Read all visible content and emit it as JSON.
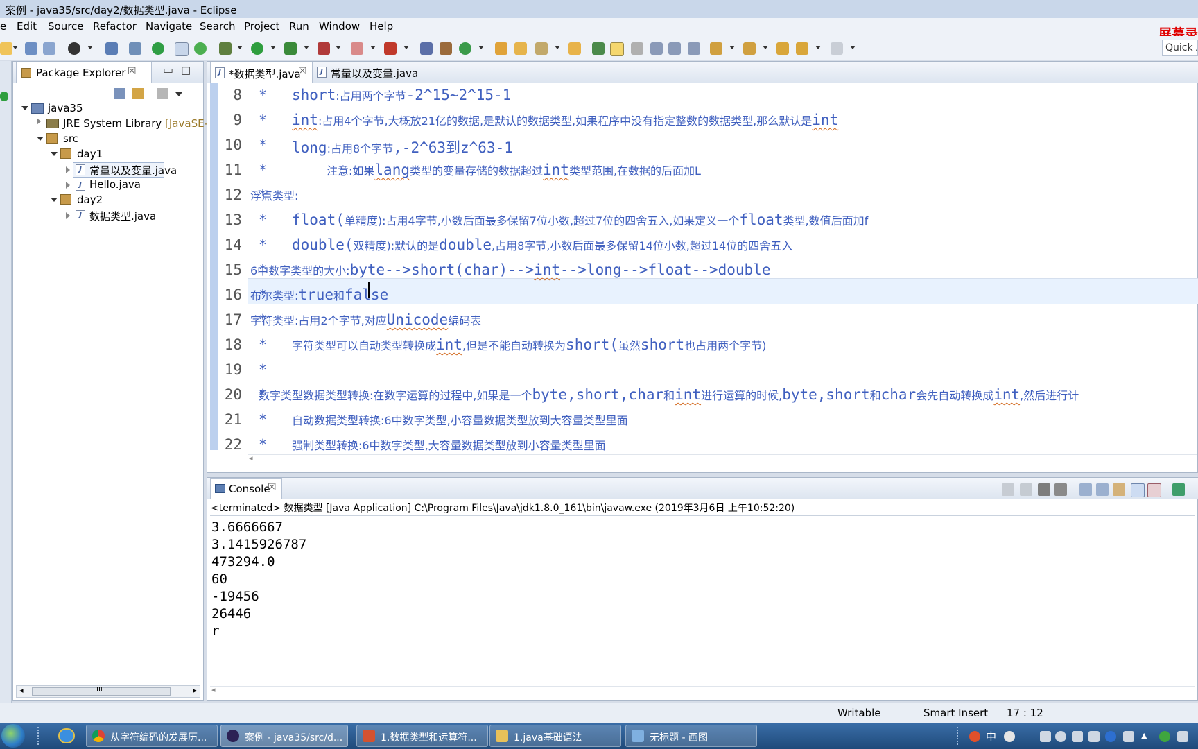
{
  "window": {
    "title": "案例 - java35/src/day2/数据类型.java - Eclipse"
  },
  "menu": [
    "e",
    "Edit",
    "Source",
    "Refactor",
    "Navigate",
    "Search",
    "Project",
    "Run",
    "Window",
    "Help"
  ],
  "overlay": {
    "screen_recorder": "屏幕录"
  },
  "quick_access": {
    "label": "Quick A"
  },
  "package_explorer": {
    "tab_label": "Package Explorer",
    "tree": [
      {
        "label": "java35"
      },
      {
        "label": "JRE System Library",
        "suffix": "[JavaSE-"
      },
      {
        "label": "src"
      },
      {
        "label": "day1"
      },
      {
        "label": "常量以及变量.java"
      },
      {
        "label": "Hello.java"
      },
      {
        "label": "day2"
      },
      {
        "label": "数据类型.java"
      }
    ],
    "hscroll_label": "III"
  },
  "editor": {
    "tabs": [
      {
        "label": "*数据类型.java",
        "active": true
      },
      {
        "label": "常量以及变量.java",
        "active": false
      }
    ],
    "lines": [
      {
        "num": "8",
        "segs": [
          "short",
          ":占用两个字节",
          "-2^15~2^15-1"
        ]
      },
      {
        "num": "9",
        "segs": [
          "int",
          ":占用4个字节,大概放21亿的数据,是默认的数据类型,如果程序中没有指定整数的数据类型,那么默认是",
          "int"
        ]
      },
      {
        "num": "10",
        "segs": [
          "long",
          ":占用8个字节",
          ",-2^63到z^63-1"
        ]
      },
      {
        "num": "11",
        "segs": [
          "注意:如果",
          "lang",
          "类型的变量存储的数据超过",
          "int",
          "类型范围,在数据的后面加L"
        ]
      },
      {
        "num": "12",
        "segs": [
          "浮点类型:"
        ]
      },
      {
        "num": "13",
        "segs": [
          "float(",
          "单精度",
          "):占用4字节,小数后面最多保留7位小数,超过7位的四舍五入,如果定义一个",
          "float",
          "类型,数值后面加f"
        ]
      },
      {
        "num": "14",
        "segs": [
          "double(",
          "双精度",
          "):默认的是",
          "double",
          ",占用8字节,小数后面最多保留14位小数,超过14位的四舍五入"
        ]
      },
      {
        "num": "15",
        "segs": [
          "6中数字类型的大小:",
          "byte-->short(char)-->",
          "int",
          "-->long-->float-->double"
        ]
      },
      {
        "num": "16",
        "segs": [
          "布尔类型:",
          "true",
          "和",
          "false"
        ]
      },
      {
        "num": "17",
        "segs": [
          "字符类型:占用2个字节,对应",
          "Unicode",
          "编码表"
        ]
      },
      {
        "num": "18",
        "segs": [
          "字符类型可以自动类型转换成",
          "int",
          ",但是不能自动转换为",
          "short(",
          "虽然",
          "short",
          "也占用两个字节)"
        ]
      },
      {
        "num": "19",
        "segs": []
      },
      {
        "num": "20",
        "segs": [
          "数字类型数据类型转换:在数字运算的过程中,如果是一个",
          "byte,short,char",
          "和",
          "int",
          "进行运算的时候,",
          "byte,short",
          "和",
          "char",
          "会先自动转换成",
          "int",
          ",然后进行计"
        ]
      },
      {
        "num": "21",
        "segs": [
          "自动数据类型转换:6中数字类型,小容量数据类型放到大容量类型里面"
        ]
      },
      {
        "num": "22",
        "segs": [
          "强制类型转换:6中数字类型,大容量数据类型放到小容量类型里面"
        ]
      }
    ],
    "star": "*"
  },
  "console": {
    "tab_label": "Console",
    "status": "<terminated> 数据类型 [Java Application] C:\\Program Files\\Java\\jdk1.8.0_161\\bin\\javaw.exe (2019年3月6日 上午10:52:20)",
    "output": [
      "3.6666667",
      "3.1415926787",
      "473294.0",
      "60",
      "-19456",
      "26446",
      "r"
    ]
  },
  "statusbar": {
    "writable": "Writable",
    "insert_mode": "Smart Insert",
    "position": "17 : 12"
  },
  "taskbar": {
    "tasks": [
      {
        "label": "从字符编码的发展历..."
      },
      {
        "label": "案例 - java35/src/d..."
      },
      {
        "label": "1.数据类型和运算符..."
      },
      {
        "label": "1.java基础语法"
      },
      {
        "label": "无标题 - 画图"
      }
    ],
    "tray": {
      "ime": "中"
    }
  }
}
